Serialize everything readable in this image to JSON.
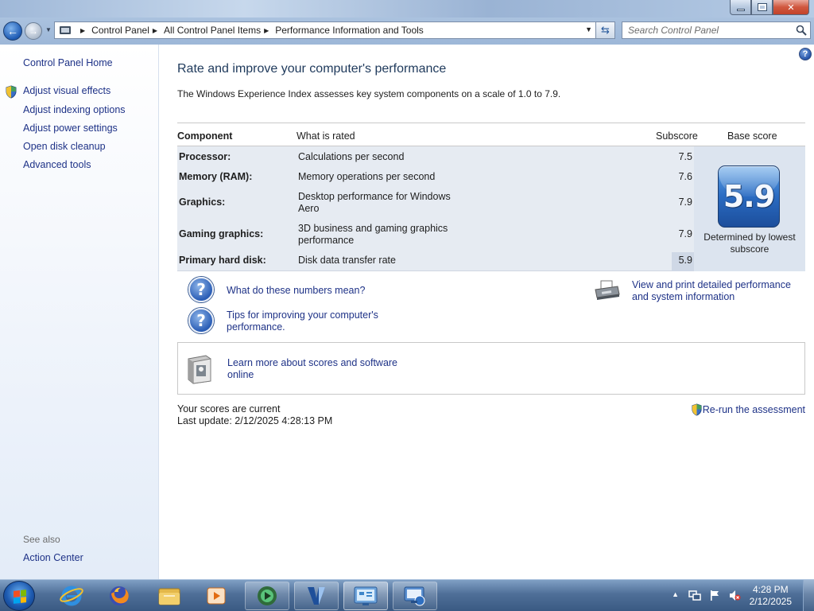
{
  "window": {
    "title": "Performance Information and Tools"
  },
  "address": {
    "crumbs": [
      "Control Panel",
      "All Control Panel Items",
      "Performance Information and Tools"
    ]
  },
  "search": {
    "placeholder": "Search Control Panel"
  },
  "sidebar": {
    "home": "Control Panel Home",
    "tasks": [
      {
        "label": "Adjust visual effects",
        "shield": true
      },
      {
        "label": "Adjust indexing options"
      },
      {
        "label": "Adjust power settings"
      },
      {
        "label": "Open disk cleanup"
      },
      {
        "label": "Advanced tools"
      }
    ],
    "see_also_label": "See also",
    "see_also": [
      "Action Center"
    ]
  },
  "main": {
    "title": "Rate and improve your computer's performance",
    "description": "The Windows Experience Index assesses key system components on a scale of 1.0 to 7.9.",
    "table": {
      "headers": {
        "component": "Component",
        "what_is_rated": "What is rated",
        "subscore": "Subscore",
        "base_score": "Base score"
      },
      "rows": [
        {
          "component": "Processor:",
          "rated": "Calculations per second",
          "subscore": "7.5"
        },
        {
          "component": "Memory (RAM):",
          "rated": "Memory operations per second",
          "subscore": "7.6"
        },
        {
          "component": "Graphics:",
          "rated": "Desktop performance for Windows Aero",
          "subscore": "7.9"
        },
        {
          "component": "Gaming graphics:",
          "rated": "3D business and gaming graphics performance",
          "subscore": "7.9"
        },
        {
          "component": "Primary hard disk:",
          "rated": "Disk data transfer rate",
          "subscore": "5.9"
        }
      ],
      "base_score": "5.9",
      "base_note": "Determined by lowest subscore"
    },
    "links": {
      "what_numbers": "What do these numbers mean?",
      "tips": "Tips for improving your computer's performance.",
      "view_print": "View and print detailed performance and system information",
      "learn_more": "Learn more about scores and software online"
    },
    "status": {
      "current": "Your scores are current",
      "last_update": "Last update: 2/12/2025 4:28:13 PM"
    },
    "rerun": "Re-run the assessment"
  },
  "taskbar": {
    "apps": [
      {
        "name": "internet-explorer",
        "state": "pinned"
      },
      {
        "name": "firefox",
        "state": "pinned"
      },
      {
        "name": "file-explorer",
        "state": "pinned"
      },
      {
        "name": "media-player",
        "state": "pinned"
      },
      {
        "name": "app-green-circle",
        "state": "open"
      },
      {
        "name": "app-blue-v",
        "state": "open"
      },
      {
        "name": "control-panel",
        "state": "active"
      },
      {
        "name": "app-network-monitor",
        "state": "open"
      }
    ],
    "clock": {
      "time": "4:28 PM",
      "date": "2/12/2025"
    }
  },
  "colors": {
    "link": "#1e3287",
    "title": "#1e395b",
    "table_band": "#e6ebf2",
    "base_badge": "#2a6bc2"
  }
}
